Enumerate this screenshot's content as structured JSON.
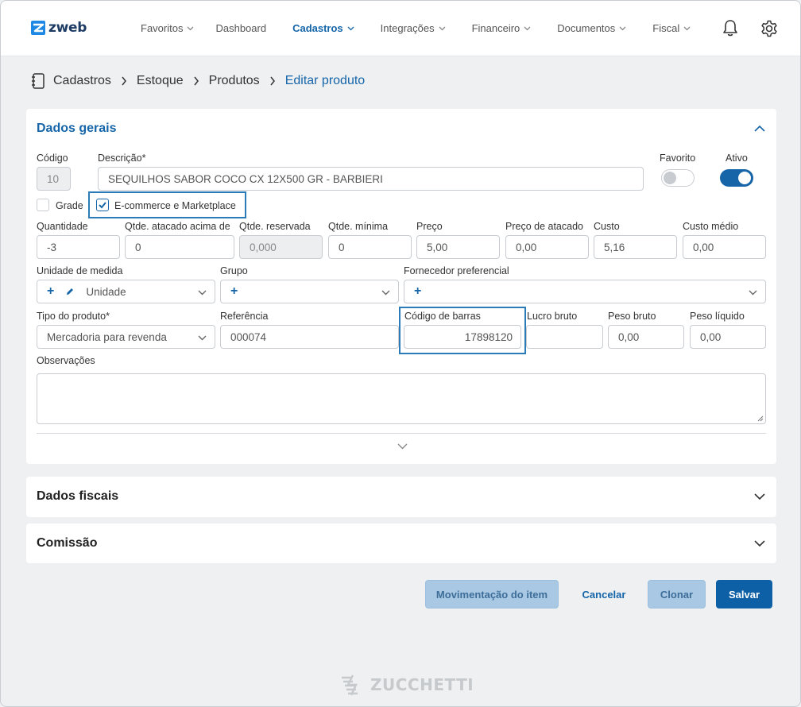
{
  "app": {
    "logo_text": "zweb",
    "brand_color": "#1565a8",
    "footer_brand": "ZUCCHETTI"
  },
  "nav": {
    "items": [
      {
        "label": "Favoritos",
        "dropdown": true,
        "active": false
      },
      {
        "label": "Dashboard",
        "dropdown": false,
        "active": false
      },
      {
        "label": "Cadastros",
        "dropdown": true,
        "active": true
      },
      {
        "label": "Integrações",
        "dropdown": true,
        "active": false
      },
      {
        "label": "Financeiro",
        "dropdown": true,
        "active": false
      },
      {
        "label": "Documentos",
        "dropdown": true,
        "active": false
      },
      {
        "label": "Fiscal",
        "dropdown": true,
        "active": false
      }
    ],
    "icons": [
      "bell-icon",
      "gear-icon"
    ]
  },
  "breadcrumb": [
    "Cadastros",
    "Estoque",
    "Produtos",
    "Editar produto"
  ],
  "general": {
    "title": "Dados gerais",
    "codigo": {
      "label": "Código",
      "value": "10"
    },
    "descricao": {
      "label": "Descrição*",
      "value": "SEQUILHOS SABOR COCO CX 12X500 GR - BARBIERI"
    },
    "favorito": {
      "label": "Favorito",
      "on": false
    },
    "ativo": {
      "label": "Ativo",
      "on": true
    },
    "grade": {
      "label": "Grade",
      "checked": false
    },
    "ecommerce": {
      "label": "E-commerce e Marketplace",
      "checked": true
    },
    "row_qty": [
      {
        "label": "Quantidade",
        "value": "-3",
        "disabled": false
      },
      {
        "label": "Qtde. atacado acima de",
        "value": "0",
        "disabled": false
      },
      {
        "label": "Qtde. reservada",
        "value": "0,000",
        "disabled": true
      },
      {
        "label": "Qtde. mínima",
        "value": "0",
        "disabled": false
      },
      {
        "label": "Preço",
        "value": "5,00",
        "disabled": false
      },
      {
        "label": "Preço de atacado",
        "value": "0,00",
        "disabled": false
      },
      {
        "label": "Custo",
        "value": "5,16",
        "disabled": false
      },
      {
        "label": "Custo médio",
        "value": "0,00",
        "disabled": false
      }
    ],
    "unidade": {
      "label": "Unidade de medida",
      "plus": "+",
      "value": "Unidade"
    },
    "grupo": {
      "label": "Grupo",
      "plus": "+"
    },
    "fornecedor": {
      "label": "Fornecedor preferencial",
      "plus": "+"
    },
    "tipo": {
      "label": "Tipo do produto*",
      "value": "Mercadoria para revenda"
    },
    "referencia": {
      "label": "Referência",
      "value": "000074"
    },
    "codigo_barras": {
      "label": "Código de barras",
      "value": "17898120"
    },
    "lucro_bruto": {
      "label": "Lucro bruto",
      "value": ""
    },
    "peso_bruto": {
      "label": "Peso bruto",
      "value": "0,00"
    },
    "peso_liquido": {
      "label": "Peso líquido",
      "value": "0,00"
    },
    "observacoes": {
      "label": "Observações",
      "value": ""
    }
  },
  "fiscal": {
    "title": "Dados fiscais"
  },
  "comissao": {
    "title": "Comissão"
  },
  "actions": {
    "movimentacao": "Movimentação do item",
    "cancelar": "Cancelar",
    "clonar": "Clonar",
    "salvar": "Salvar"
  }
}
